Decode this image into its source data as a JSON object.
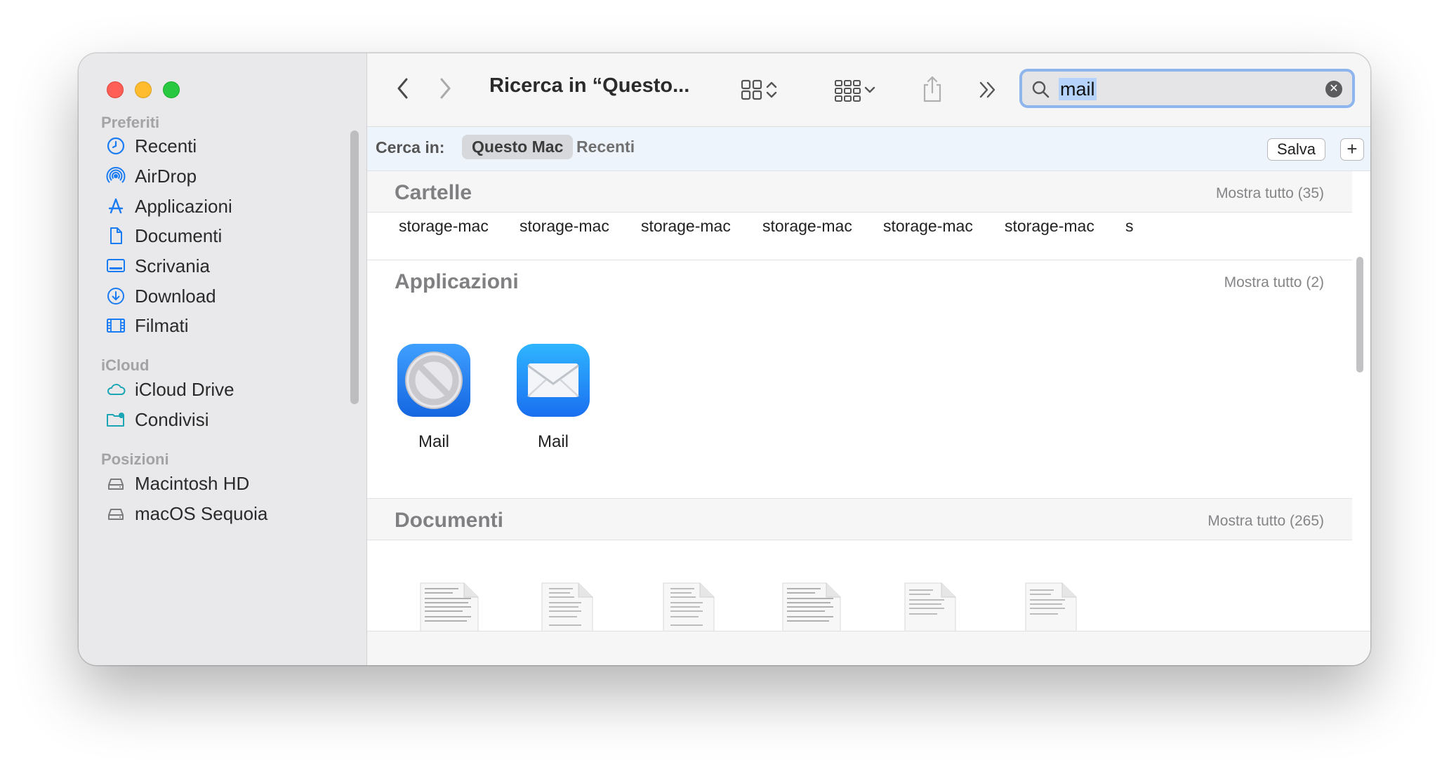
{
  "window": {
    "title": "Ricerca in “Questo...",
    "search": {
      "value": "mail"
    }
  },
  "sidebar": {
    "sections": [
      {
        "label": "Preferiti",
        "items": [
          {
            "label": "Recenti",
            "icon": "clock-icon"
          },
          {
            "label": "AirDrop",
            "icon": "airdrop-icon"
          },
          {
            "label": "Applicazioni",
            "icon": "applications-icon"
          },
          {
            "label": "Documenti",
            "icon": "document-icon"
          },
          {
            "label": "Scrivania",
            "icon": "desktop-icon"
          },
          {
            "label": "Download",
            "icon": "download-icon"
          },
          {
            "label": "Filmati",
            "icon": "film-icon"
          }
        ]
      },
      {
        "label": "iCloud",
        "items": [
          {
            "label": "iCloud Drive",
            "icon": "icloud-icon"
          },
          {
            "label": "Condivisi",
            "icon": "shared-folder-icon"
          }
        ]
      },
      {
        "label": "Posizioni",
        "items": [
          {
            "label": "Macintosh HD",
            "icon": "disk-icon"
          },
          {
            "label": "macOS Sequoia",
            "icon": "disk-icon"
          }
        ]
      }
    ]
  },
  "scope": {
    "label": "Cerca in:",
    "selected": "Questo Mac",
    "other": "Recenti",
    "save": "Salva",
    "add": "+"
  },
  "results": {
    "folders": {
      "title": "Cartelle",
      "more": "Mostra tutto (35)",
      "items": [
        "storage-mac",
        "storage-mac",
        "storage-mac",
        "storage-mac",
        "storage-mac",
        "storage-mac",
        "s"
      ]
    },
    "apps": {
      "title": "Applicazioni",
      "more": "Mostra tutto (2)",
      "items": [
        "Mail",
        "Mail"
      ]
    },
    "documents": {
      "title": "Documenti",
      "more": "Mostra tutto (265)"
    }
  },
  "colors": {
    "accent": "#1a7cf3",
    "sidebar_bg": "#e9e8ea",
    "search_focus": "#8fb6ec",
    "traffic_red": "#ff5f57",
    "traffic_yellow": "#febc2e",
    "traffic_green": "#28c840"
  }
}
